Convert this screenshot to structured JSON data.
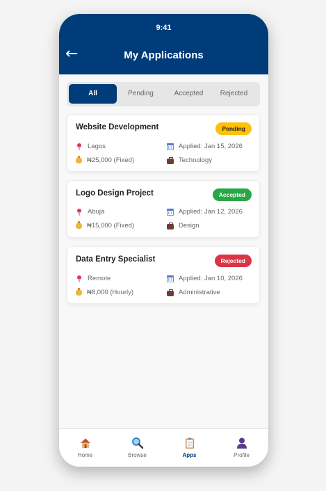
{
  "status_bar": {
    "time": "9:41"
  },
  "header": {
    "back_icon": "back-arrow-icon",
    "title": "My Applications"
  },
  "tabs": [
    {
      "label": "All",
      "active": true
    },
    {
      "label": "Pending",
      "active": false
    },
    {
      "label": "Accepted",
      "active": false
    },
    {
      "label": "Rejected",
      "active": false
    }
  ],
  "applications": [
    {
      "title": "Website Development",
      "status": "Pending",
      "status_color": "#ffc107",
      "status_text_color": "#1f1f1f",
      "location": "Lagos",
      "applied": "Applied: Jan 15, 2026",
      "pay": "₦25,000 (Fixed)",
      "category": "Technology"
    },
    {
      "title": "Logo Design Project",
      "status": "Accepted",
      "status_color": "#28a745",
      "status_text_color": "#ffffff",
      "location": "Abuja",
      "applied": "Applied: Jan 12, 2026",
      "pay": "₦15,000 (Fixed)",
      "category": "Design"
    },
    {
      "title": "Data Entry Specialist",
      "status": "Rejected",
      "status_color": "#dc3545",
      "status_text_color": "#ffffff",
      "location": "Remote",
      "applied": "Applied: Jan 10, 2026",
      "pay": "₦8,000 (Hourly)",
      "category": "Administrative"
    }
  ],
  "bottom_nav": [
    {
      "label": "Home",
      "icon": "home-icon",
      "active": false
    },
    {
      "label": "Browse",
      "icon": "search-icon",
      "active": false
    },
    {
      "label": "Apps",
      "icon": "clipboard-icon",
      "active": true
    },
    {
      "label": "Profile",
      "icon": "profile-icon",
      "active": false
    }
  ],
  "colors": {
    "primary": "#003c7a",
    "background": "#f8f8f8"
  }
}
